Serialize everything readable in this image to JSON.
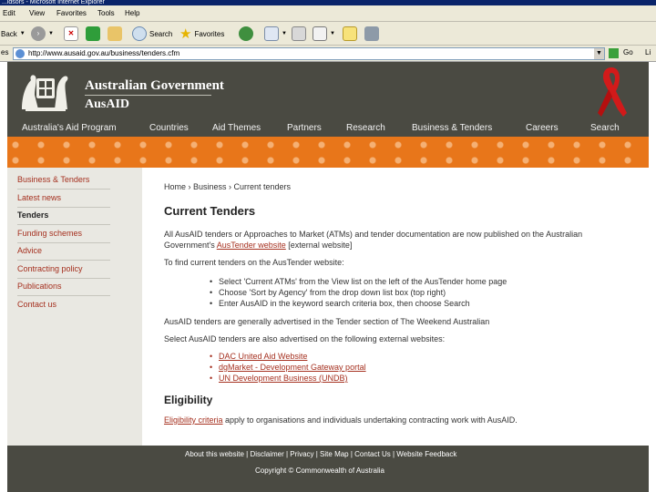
{
  "window": {
    "title": "...idsors - Microsoft Internet Explorer"
  },
  "menu": [
    "Edit",
    "View",
    "Favorites",
    "Tools",
    "Help"
  ],
  "toolbar": {
    "back": "Back",
    "search": "Search",
    "favorites": "Favorites"
  },
  "address": {
    "label": "es",
    "url": "http://www.ausaid.gov.au/business/tenders.cfm",
    "go": "Go",
    "links": "Li"
  },
  "site": {
    "government": "Australian Government",
    "agency": "AusAID"
  },
  "top_nav": [
    "Australia's Aid Program",
    "Countries",
    "Aid Themes",
    "Partners",
    "Research",
    "Business & Tenders",
    "Careers",
    "Search"
  ],
  "side_nav": [
    "Business & Tenders",
    "Latest news",
    "Tenders",
    "Funding schemes",
    "Advice",
    "Contracting policy",
    "Publications",
    "Contact us"
  ],
  "breadcrumb": "Home › Business › Current tenders",
  "main": {
    "title": "Current Tenders",
    "intro_1": "All AusAID tenders or Approaches to Market (ATMs) and tender documentation are now published on the Australian",
    "intro_2a": "Government's ",
    "intro_link": "AusTender website",
    "intro_2b": " [external website]",
    "find_text": "To find current tenders on the AusTender website:",
    "steps": [
      "Select 'Current ATMs' from the View list on the left of the AusTender home page",
      "Choose 'Sort by Agency' from the drop down list box (top right)",
      "Enter AusAID in the keyword search criteria box, then choose Search"
    ],
    "advertised": "AusAID tenders are generally advertised in the Tender section of The Weekend Australian",
    "select_text": "Select AusAID tenders are also advertised on the following external websites:",
    "external_links": [
      "DAC United Aid Website",
      "dgMarket - Development Gateway portal",
      "UN Development Business (UNDB)"
    ],
    "eligibility_heading": "Eligibility",
    "eligibility_link": "Eligibility criteria",
    "eligibility_text": " apply to organisations and individuals undertaking contracting work with AusAID."
  },
  "footer": {
    "links": "About this website | Disclaimer | Privacy | Site Map | Contact Us | Website Feedback",
    "copyright": "Copyright © Commonwealth of Australia"
  },
  "colors": {
    "header": "#4a4a42",
    "pattern": "#e8761a",
    "link": "#a5301f",
    "sidebar": "#e9e8e2"
  }
}
